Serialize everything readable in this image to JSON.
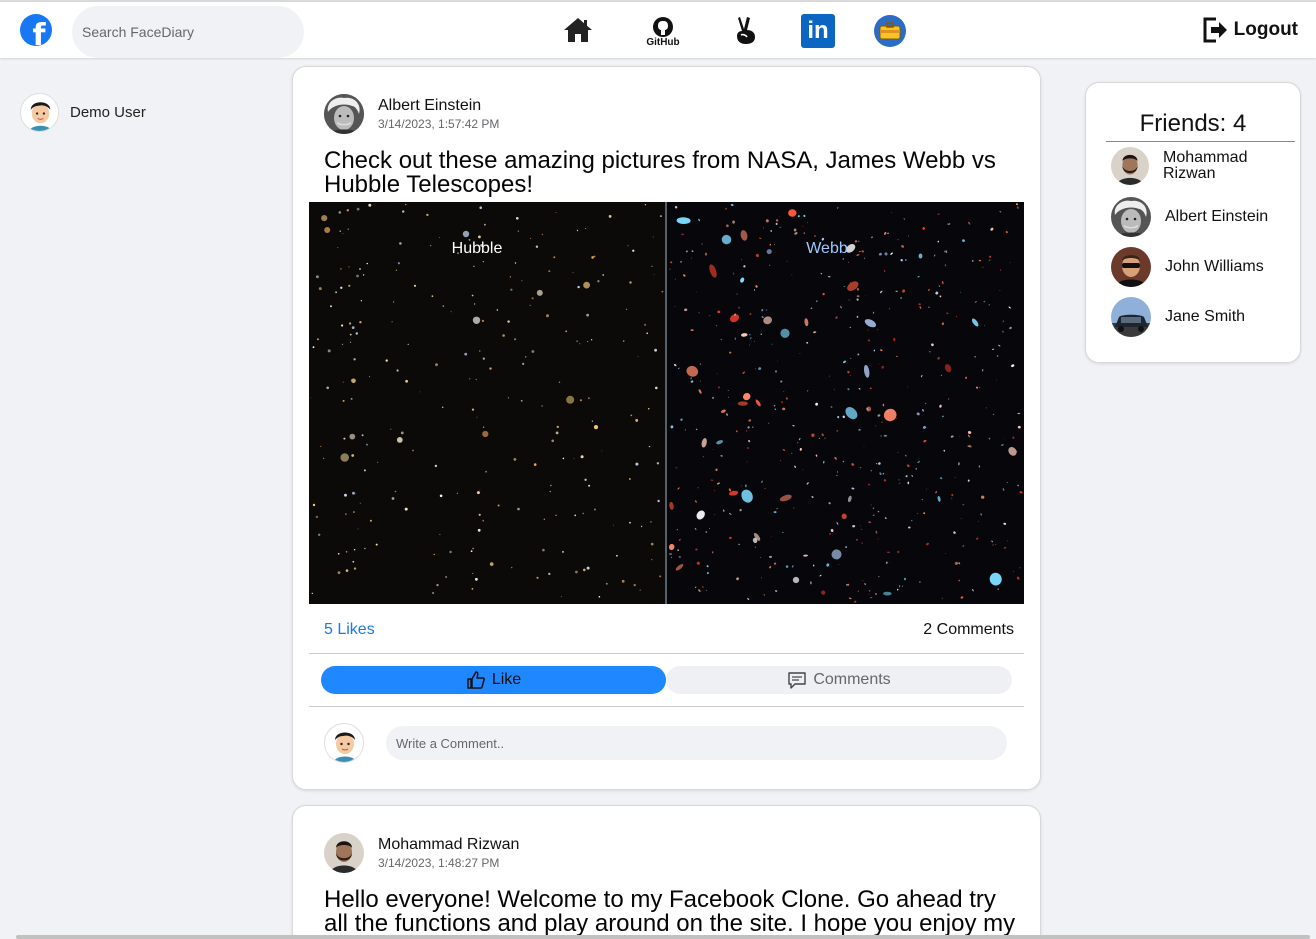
{
  "search": {
    "placeholder": "Search FaceDiary"
  },
  "nav": {
    "items": [
      {
        "name": "home-icon"
      },
      {
        "name": "github-icon",
        "label": "GitHub"
      },
      {
        "name": "angellist-icon"
      },
      {
        "name": "linkedin-icon"
      },
      {
        "name": "portfolio-icon"
      }
    ],
    "logout_label": "Logout"
  },
  "current_user": {
    "name": "Demo User"
  },
  "posts": [
    {
      "author": "Albert Einstein",
      "timestamp": "3/14/2023, 1:57:42 PM",
      "text": "Check out these amazing pictures from NASA, James Webb vs Hubble Telescopes!",
      "image": {
        "left_label": "Hubble",
        "right_label": "Webb"
      },
      "likes": "5 Likes",
      "comments": "2 Comments",
      "like_label": "Like",
      "comments_label": "Comments",
      "comment_placeholder": "Write a Comment.."
    },
    {
      "author": "Mohammad Rizwan",
      "timestamp": "3/14/2023, 1:48:27 PM",
      "text": "Hello everyone! Welcome to my Facebook Clone. Go ahead try all the functions and play around on the site. I hope you enjoy my"
    }
  ],
  "friends": {
    "title": "Friends: 4",
    "list": [
      {
        "name": "Mohammad Rizwan"
      },
      {
        "name": "Albert Einstein"
      },
      {
        "name": "John Williams"
      },
      {
        "name": "Jane Smith"
      }
    ]
  },
  "colors": {
    "brand": "#1877f2",
    "like_button": "#1f87ff",
    "background": "#f0f2f5"
  }
}
